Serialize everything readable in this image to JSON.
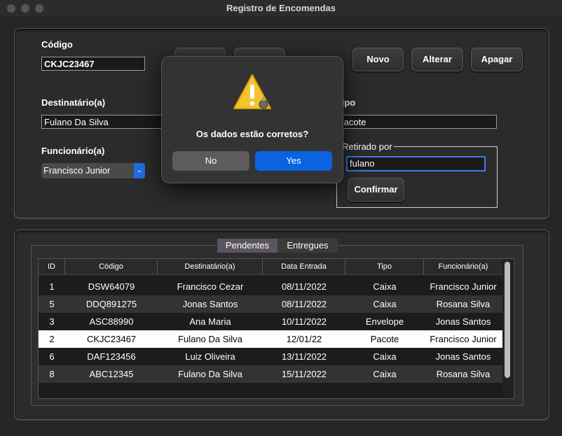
{
  "window": {
    "title": "Registro de Encomendas"
  },
  "form": {
    "codigo_label": "Código",
    "codigo_value": "CKJC23467",
    "destinatario_label": "Destinatário(a)",
    "destinatario_value": "Fulano Da Silva",
    "funcionario_label": "Funcionário(a)",
    "funcionario_value": "Francisco Junior",
    "tipo_label": "Tipo",
    "tipo_value": "Pacote",
    "retirado_label": "Retirado por",
    "retirado_value": "fulano",
    "confirmar_label": "Confirmar"
  },
  "toolbar": {
    "novo": "Novo",
    "alterar": "Alterar",
    "apagar": "Apagar"
  },
  "tabs": [
    {
      "label": "Pendentes",
      "active": true
    },
    {
      "label": "Entregues",
      "active": false
    }
  ],
  "table": {
    "headers": [
      "ID",
      "Código",
      "Destinatário(a)",
      "Data Entrada",
      "Tipo",
      "Funcionário(a)"
    ],
    "rows": [
      [
        "1",
        "DSW64079",
        "Francisco Cezar",
        "08/11/2022",
        "Caixa",
        "Francisco Junior"
      ],
      [
        "5",
        "DDQ891275",
        "Jonas Santos",
        "08/11/2022",
        "Caixa",
        "Rosana Silva"
      ],
      [
        "3",
        "ASC88990",
        "Ana Maria",
        "10/11/2022",
        "Envelope",
        "Jonas Santos"
      ],
      [
        "2",
        "CKJC23467",
        "Fulano Da Silva",
        "12/01/22",
        "Pacote",
        "Francisco Junior"
      ],
      [
        "6",
        "DAF123456",
        "Luiz Oliveira",
        "13/11/2022",
        "Caixa",
        "Jonas Santos"
      ],
      [
        "8",
        "ABC12345",
        "Fulano Da Silva",
        "15/11/2022",
        "Caixa",
        "Rosana Silva"
      ]
    ],
    "selected_row": 3
  },
  "dialog": {
    "message": "Os dados estão corretos?",
    "no_label": "No",
    "yes_label": "Yes",
    "icon": "warning-icon"
  },
  "colors": {
    "accent": "#1f6de0",
    "yes_button": "#0a63e0"
  }
}
